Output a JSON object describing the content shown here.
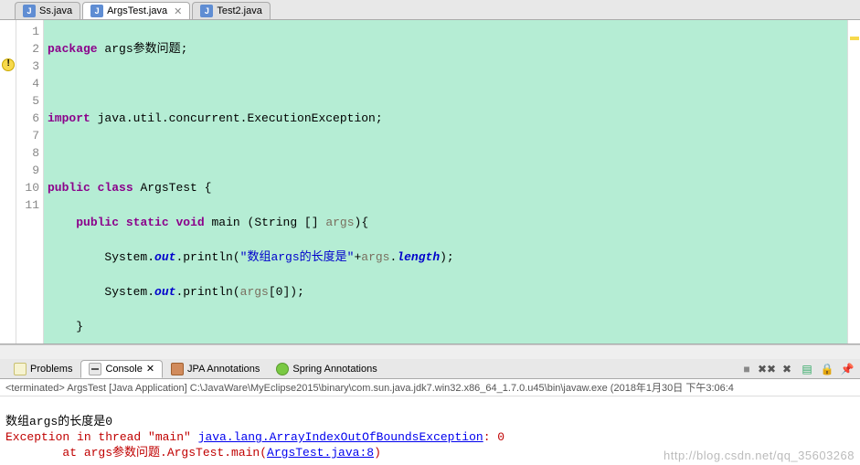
{
  "tabs": [
    {
      "label": "Ss.java",
      "active": false
    },
    {
      "label": "ArgsTest.java",
      "active": true
    },
    {
      "label": "Test2.java",
      "active": false
    }
  ],
  "gutter_lines": [
    "1",
    "2",
    "3",
    "4",
    "5",
    "6",
    "7",
    "8",
    "9",
    "10",
    "11"
  ],
  "code": {
    "l1_kw1": "package",
    "l1_rest": " args参数问题;",
    "l3_kw1": "import",
    "l3_rest": " java.util.concurrent.ExecutionException;",
    "l5_kw1": "public",
    "l5_kw2": "class",
    "l5_name": " ArgsTest ",
    "l5_brace": "{",
    "l6_indent": "    ",
    "l6_kw1": "public",
    "l6_kw2": "static",
    "l6_kw3": "void",
    "l6_name": " main ",
    "l6_paren_o": "(",
    "l6_type": "String ",
    "l6_brackets": "[] ",
    "l6_arg": "args",
    "l6_paren_c": ")",
    "l6_brace": "{",
    "l7_indent": "        ",
    "l7_sys": "System.",
    "l7_out": "out",
    "l7_call": ".println(",
    "l7_str": "\"数组args的长度是\"",
    "l7_plus": "+",
    "l7_args": "args",
    "l7_dot": ".",
    "l7_len": "length",
    "l7_end": ");",
    "l8_indent": "        ",
    "l8_sys": "System.",
    "l8_out": "out",
    "l8_call": ".println(",
    "l8_args": "args",
    "l8_idx": "[0]);",
    "l9_indent": "    ",
    "l9_brace": "}",
    "l10_brace": "}"
  },
  "warning_line": 3,
  "panel_tabs": [
    {
      "label": "Problems",
      "kind": "prob",
      "active": false
    },
    {
      "label": "Console",
      "kind": "cons",
      "active": true
    },
    {
      "label": "JPA Annotations",
      "kind": "jpa",
      "active": false
    },
    {
      "label": "Spring Annotations",
      "kind": "spr",
      "active": false
    }
  ],
  "status": "<terminated> ArgsTest [Java Application] C:\\JavaWare\\MyEclipse2015\\binary\\com.sun.java.jdk7.win32.x86_64_1.7.0.u45\\bin\\javaw.exe (2018年1月30日 下午3:06:4",
  "console": {
    "line1": "数组args的长度是0",
    "line2_a": "Exception in thread \"main\" ",
    "line2_link": "java.lang.ArrayIndexOutOfBoundsException",
    "line2_b": ": 0",
    "line3_a": "        at args参数问题.ArgsTest.main(",
    "line3_link": "ArgsTest.java:8",
    "line3_b": ")"
  },
  "watermark": "http://blog.csdn.net/qq_35603268",
  "toolbar_icons": [
    "stop-icon",
    "remove-all-icon",
    "remove-launch-icon",
    "clear-icon",
    "scroll-lock-icon",
    "pin-icon"
  ]
}
